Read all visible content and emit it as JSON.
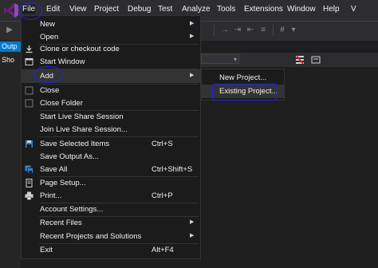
{
  "menubar": {
    "items": [
      "File",
      "Edit",
      "View",
      "Project",
      "Debug",
      "Test",
      "Analyze",
      "Tools",
      "Extensions",
      "Window",
      "Help"
    ],
    "extra_text": "V"
  },
  "left_panel": {
    "output_tab": "Outp",
    "show_label": "Sho"
  },
  "file_menu": {
    "items": [
      {
        "label": "New",
        "has_submenu": true,
        "icon": "none"
      },
      {
        "label": "Open",
        "has_submenu": true,
        "icon": "none"
      },
      {
        "label": "Clone or checkout code",
        "icon": "clone-icon"
      },
      {
        "label": "Start Window",
        "icon": "start-window-icon"
      },
      {
        "label": "Add",
        "has_submenu": true,
        "highlighted": true,
        "icon": "none"
      },
      {
        "label": "Close",
        "icon": "close-icon"
      },
      {
        "label": "Close Folder",
        "icon": "close-folder-icon"
      },
      {
        "label": "Start Live Share Session",
        "icon": "none"
      },
      {
        "label": "Join Live Share Session...",
        "icon": "none"
      },
      {
        "label": "Save Selected Items",
        "shortcut": "Ctrl+S",
        "icon": "save-icon"
      },
      {
        "label": "Save Output As...",
        "icon": "none"
      },
      {
        "label": "Save All",
        "shortcut": "Ctrl+Shift+S",
        "icon": "save-all-icon"
      },
      {
        "label": "Page Setup...",
        "icon": "page-setup-icon"
      },
      {
        "label": "Print...",
        "shortcut": "Ctrl+P",
        "icon": "print-icon"
      },
      {
        "label": "Account Settings...",
        "icon": "none"
      },
      {
        "label": "Recent Files",
        "has_submenu": true,
        "icon": "none"
      },
      {
        "label": "Recent Projects and Solutions",
        "has_submenu": true,
        "icon": "none"
      },
      {
        "label": "Exit",
        "shortcut": "Alt+F4",
        "icon": "none"
      }
    ]
  },
  "add_submenu": {
    "items": [
      {
        "label": "New Project..."
      },
      {
        "label": "Existing Project...",
        "highlighted": true
      }
    ]
  },
  "colors": {
    "menu_bg": "#1b1b1c",
    "highlight": "#333334",
    "accent": "#007acc",
    "annotation": "#2222ee"
  }
}
